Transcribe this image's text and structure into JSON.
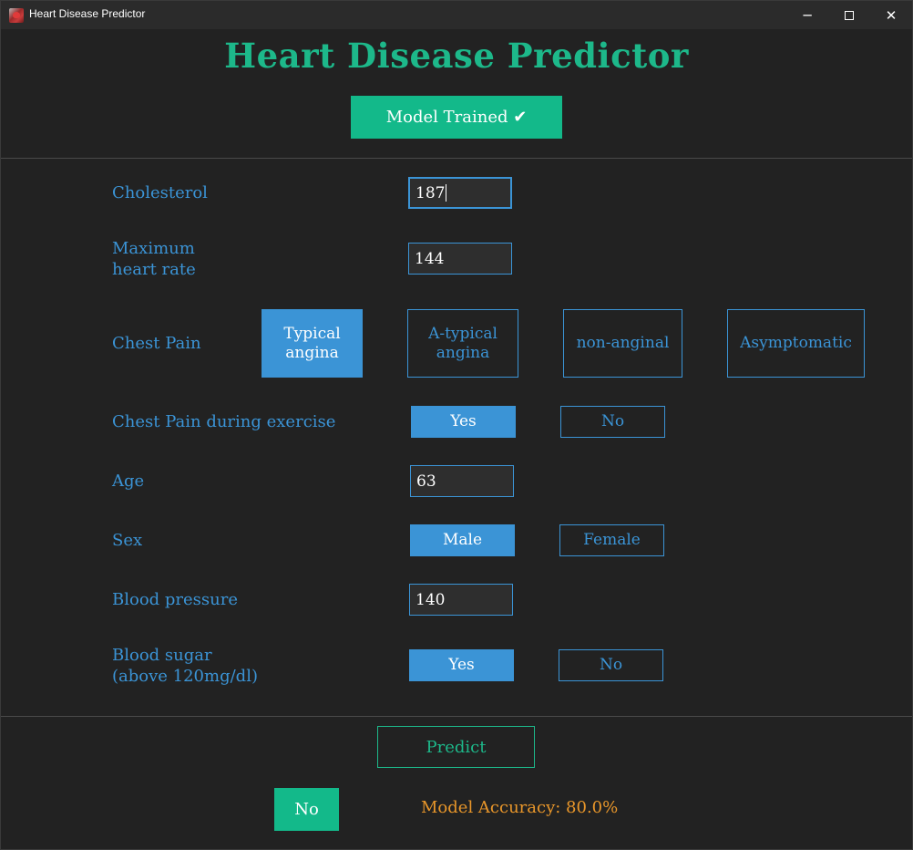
{
  "window": {
    "title": "Heart Disease Predictor",
    "controls": {
      "minimize": "─",
      "close": "✕"
    }
  },
  "header": {
    "title": "Heart Disease Predictor",
    "trained_label": "Model Trained ✔"
  },
  "form": {
    "cholesterol": {
      "label": "Cholesterol",
      "value": "187"
    },
    "max_heart_rate": {
      "label_line1": "Maximum",
      "label_line2": "heart rate",
      "value": "144"
    },
    "chest_pain": {
      "label": "Chest Pain",
      "options": [
        {
          "line1": "Typical",
          "line2": "angina",
          "selected": true
        },
        {
          "line1": "A-typical",
          "line2": "angina",
          "selected": false
        },
        {
          "line1": "non-anginal",
          "line2": "",
          "selected": false
        },
        {
          "line1": "Asymptomatic",
          "line2": "",
          "selected": false
        }
      ]
    },
    "exercise_pain": {
      "label": "Chest Pain during exercise",
      "yes": "Yes",
      "no": "No",
      "selected": "Yes"
    },
    "age": {
      "label": "Age",
      "value": "63"
    },
    "sex": {
      "label": "Sex",
      "male": "Male",
      "female": "Female",
      "selected": "Male"
    },
    "blood_pressure": {
      "label": "Blood pressure",
      "value": "140"
    },
    "blood_sugar": {
      "label_line1": "Blood sugar",
      "label_line2": "(above 120mg/dl)",
      "yes": "Yes",
      "no": "No",
      "selected": "Yes"
    }
  },
  "footer": {
    "predict_label": "Predict",
    "result": "No",
    "accuracy": "Model Accuracy: 80.0%"
  },
  "colors": {
    "background": "#222222",
    "accent_green": "#13b98a",
    "accent_blue": "#3b94d6",
    "accuracy_orange": "#e8962a"
  }
}
